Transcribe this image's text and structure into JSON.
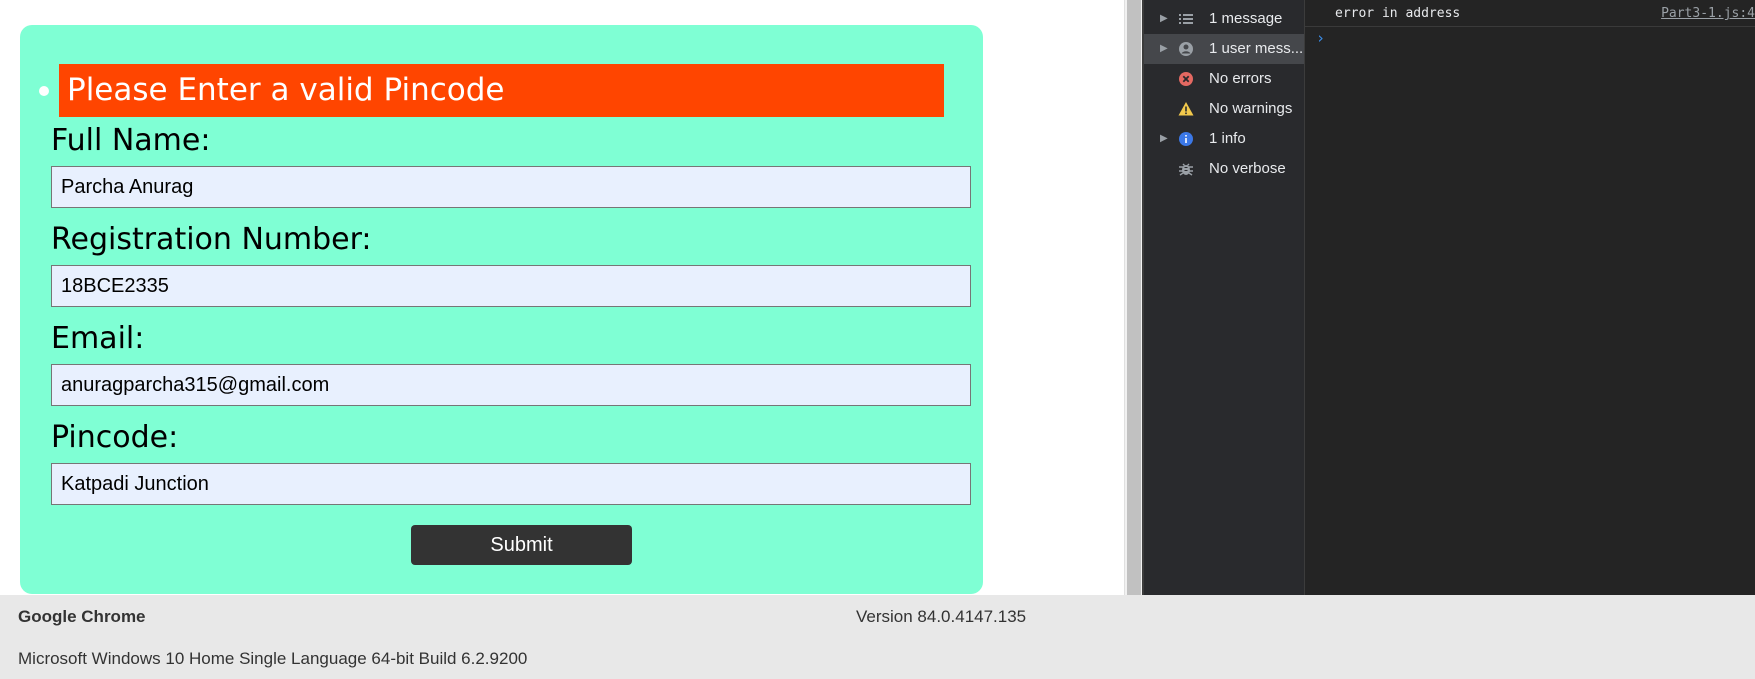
{
  "form": {
    "error_message": "Please Enter a valid Pincode",
    "fields": [
      {
        "label": "Full Name:",
        "value": "Parcha Anurag"
      },
      {
        "label": "Registration Number:",
        "value": "18BCE2335"
      },
      {
        "label": "Email:",
        "value": "anuragparcha315@gmail.com"
      },
      {
        "label": "Pincode:",
        "value": "Katpadi Junction"
      }
    ],
    "submit_label": "Submit"
  },
  "devtools": {
    "sidebar": [
      {
        "label": "1 message",
        "icon": "list-icon",
        "expandable": true,
        "selected": false
      },
      {
        "label": "1 user mess...",
        "icon": "user-icon",
        "expandable": true,
        "selected": true
      },
      {
        "label": "No errors",
        "icon": "error-icon",
        "expandable": false,
        "selected": false
      },
      {
        "label": "No warnings",
        "icon": "warning-icon",
        "expandable": false,
        "selected": false
      },
      {
        "label": "1 info",
        "icon": "info-icon",
        "expandable": true,
        "selected": false
      },
      {
        "label": "No verbose",
        "icon": "bug-icon",
        "expandable": false,
        "selected": false
      }
    ],
    "console": {
      "message": "error in address",
      "source": "Part3-1.js:4",
      "prompt": "›"
    }
  },
  "info_bar": {
    "browser": "Google Chrome",
    "version": "Version 84.0.4147.135",
    "os": "Microsoft Windows 10 Home Single Language 64-bit Build 6.2.9200"
  },
  "colors": {
    "form_background": "#7fffd4",
    "error_background": "#ff4500",
    "input_background": "#e8f0fe",
    "button_background": "#333333",
    "devtools_background": "#242424"
  }
}
